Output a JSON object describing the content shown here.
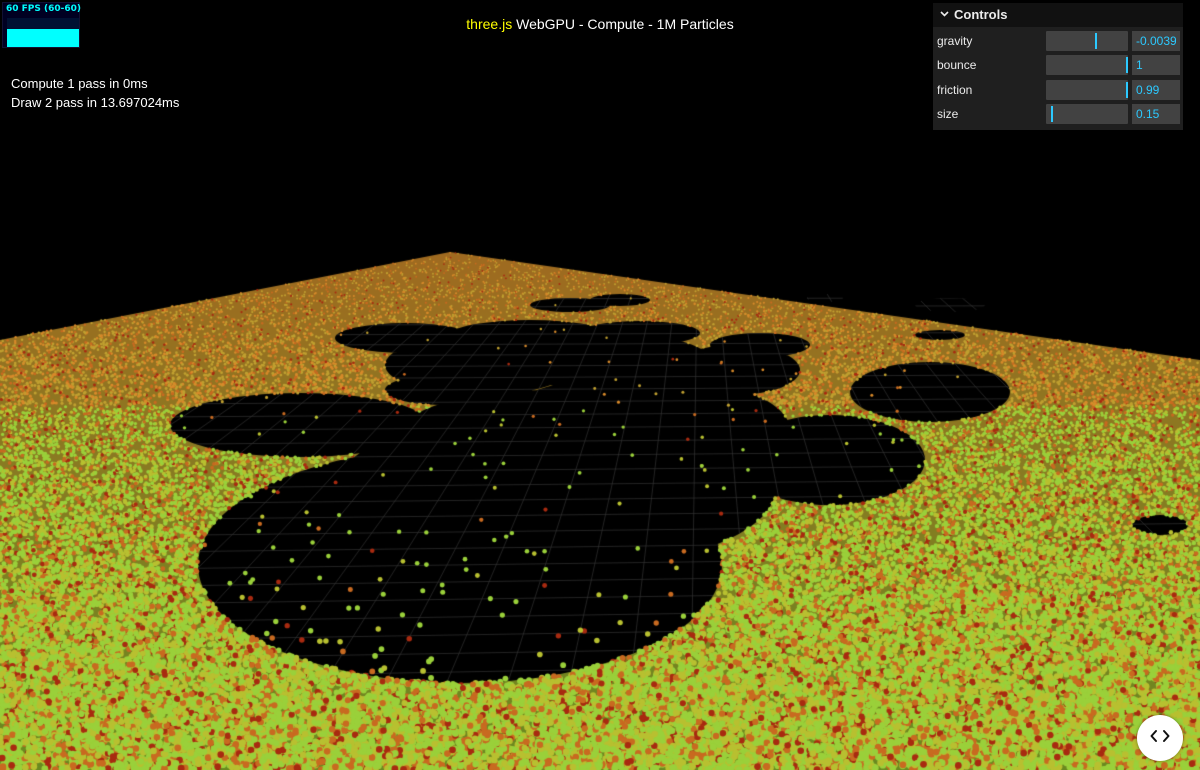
{
  "stats": {
    "fps_text": "60 FPS (60-60)",
    "fps_fraction": 0.62
  },
  "header": {
    "link_text": "three.js",
    "title_rest": " WebGPU - Compute - 1M Particles"
  },
  "info": {
    "compute": "Compute 1 pass in 0ms",
    "draw": "Draw 2 pass in 13.697024ms"
  },
  "gui": {
    "title": "Controls",
    "controls": [
      {
        "label": "gravity",
        "value": "-0.0039",
        "fraction": 0.61
      },
      {
        "label": "bounce",
        "value": "1",
        "fraction": 0.99
      },
      {
        "label": "friction",
        "value": "0.99",
        "fraction": 0.99
      },
      {
        "label": "size",
        "value": "0.15",
        "fraction": 0.07
      }
    ]
  },
  "colors": {
    "accent": "#2cc9ff",
    "fps": "#00ffff",
    "title_link": "#ffff00",
    "particle_green": "#9ad03a",
    "particle_orange": "#d88a2a",
    "particle_red": "#c83a1a",
    "grid": "#3a3a3a"
  },
  "icons": {
    "code_button": "code-brackets-icon",
    "gui_toggle": "chevron-down-icon"
  }
}
